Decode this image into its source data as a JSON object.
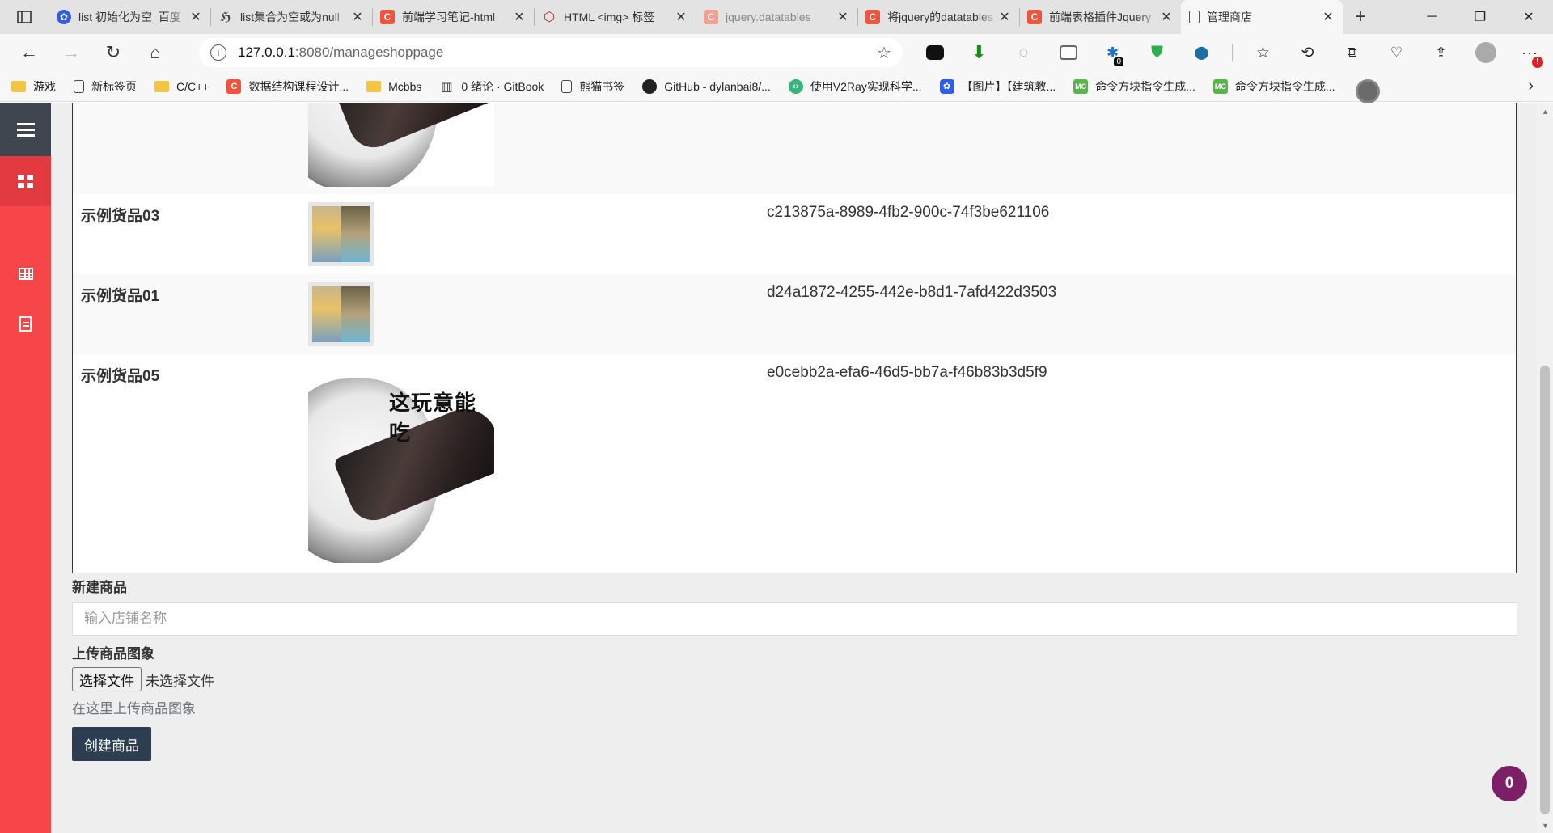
{
  "browser": {
    "tabs": [
      {
        "title": "list 初始化为空_百度",
        "icon": "baidu-paw-icon"
      },
      {
        "title": "list集合为空或为null",
        "icon": "w3-icon"
      },
      {
        "title": "前端学习笔记-html",
        "icon": "csdn-icon"
      },
      {
        "title": "HTML <img> 标签",
        "icon": "html-icon"
      },
      {
        "title": "jquery.datatables",
        "icon": "csdn-icon"
      },
      {
        "title": "将jquery的datatables",
        "icon": "csdn-icon"
      },
      {
        "title": "前端表格插件Jquery",
        "icon": "csdn-icon"
      },
      {
        "title": "管理商店",
        "icon": "page-icon",
        "active": true
      }
    ],
    "address": {
      "host": "127.0.0.1",
      "path": ":8080/manageshoppage"
    },
    "extension_badge": "0",
    "bookmarks": [
      {
        "label": "游戏",
        "icon": "folder-icon"
      },
      {
        "label": "新标签页",
        "icon": "page-icon"
      },
      {
        "label": "C/C++",
        "icon": "folder-icon"
      },
      {
        "label": "数据结构课程设计...",
        "icon": "csdn-icon"
      },
      {
        "label": "Mcbbs",
        "icon": "folder-icon"
      },
      {
        "label": "0 绪论 · GitBook",
        "icon": "book-icon"
      },
      {
        "label": "熊猫书签",
        "icon": "page-icon"
      },
      {
        "label": "GitHub - dylanbai8/...",
        "icon": "github-icon"
      },
      {
        "label": "使用V2Ray实现科学...",
        "icon": "v2ray-icon"
      },
      {
        "label": "【图片】【建筑教...",
        "icon": "baidu-paw-icon"
      },
      {
        "label": "命令方块指令生成...",
        "icon": "mc-icon"
      },
      {
        "label": "命令方块指令生成...",
        "icon": "mc-icon"
      }
    ]
  },
  "products": [
    {
      "name": "",
      "image": "meme-large",
      "id": ""
    },
    {
      "name": "示例货品03",
      "image": "thumb-anime",
      "id": "c213875a-8989-4fb2-900c-74f3be621106"
    },
    {
      "name": "示例货品01",
      "image": "thumb-anime",
      "id": "d24a1872-4255-442e-b8d1-7afd422d3503"
    },
    {
      "name": "示例货品05",
      "image": "meme-large",
      "id": "e0cebb2a-efa6-46d5-bb7a-f46b83b3d5f9"
    }
  ],
  "meme_caption": "这玩意能吃",
  "form": {
    "new_product_label": "新建商品",
    "name_placeholder": "输入店铺名称",
    "upload_label": "上传商品图象",
    "file_button": "选择文件",
    "file_status": "未选择文件",
    "upload_help": "在这里上传商品图象",
    "create_button": "创建商品"
  },
  "counter_badge": "0",
  "colors": {
    "sidebar": "#f7464a",
    "sidebar_top": "#3f4650",
    "primary_button": "#2c3e50",
    "counter": "#7b1f66"
  }
}
